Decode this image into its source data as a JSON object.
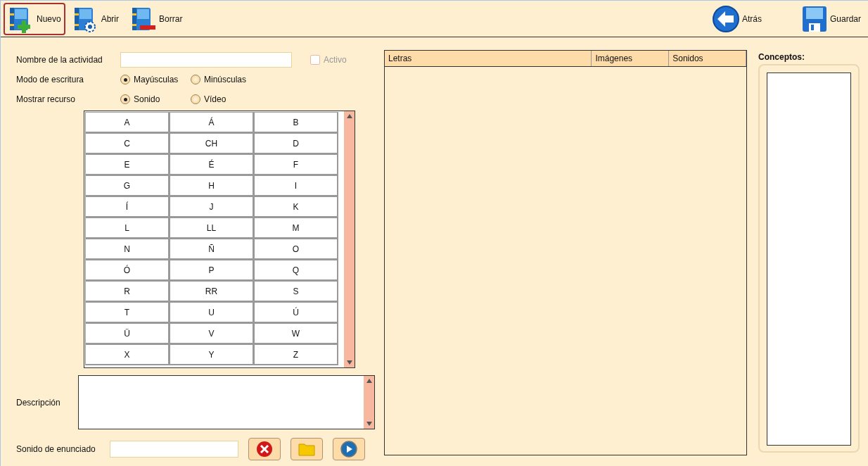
{
  "toolbar": {
    "left": [
      {
        "kind": "new",
        "label": "Nuevo",
        "selected": true
      },
      {
        "kind": "open",
        "label": "Abrir",
        "selected": false
      },
      {
        "kind": "delete",
        "label": "Borrar",
        "selected": false
      }
    ],
    "right": [
      {
        "kind": "back",
        "label": "Atrás",
        "selected": false
      },
      {
        "kind": "save",
        "label": "Guardar",
        "selected": false
      }
    ]
  },
  "form": {
    "name_label": "Nombre de la actividad",
    "active": {
      "label": "Activo",
      "checked": false,
      "disabled": true
    },
    "radio_groups": [
      {
        "label": "Modo de escritura",
        "options": [
          {
            "label": "Mayúsculas",
            "selected": true
          },
          {
            "label": "Minúsculas",
            "selected": false
          }
        ]
      },
      {
        "label": "Mostrar recurso",
        "options": [
          {
            "label": "Sonido",
            "selected": true
          },
          {
            "label": "Vídeo",
            "selected": false
          }
        ]
      }
    ],
    "letters": [
      "A",
      "Á",
      "B",
      "C",
      "CH",
      "D",
      "E",
      "É",
      "F",
      "G",
      "H",
      "I",
      "Í",
      "J",
      "K",
      "L",
      "LL",
      "M",
      "N",
      "Ñ",
      "O",
      "Ó",
      "P",
      "Q",
      "R",
      "RR",
      "S",
      "T",
      "U",
      "Ú",
      "Ü",
      "V",
      "W",
      "X",
      "Y",
      "Z"
    ],
    "description_label": "Descripción",
    "sound_label": "Sonido de enunciado",
    "sound_buttons": [
      {
        "kind": "clear"
      },
      {
        "kind": "folder"
      },
      {
        "kind": "play"
      }
    ]
  },
  "table": {
    "columns": [
      "Letras",
      "Imágenes",
      "Sonidos"
    ]
  },
  "concepts": {
    "label": "Conceptos:"
  }
}
